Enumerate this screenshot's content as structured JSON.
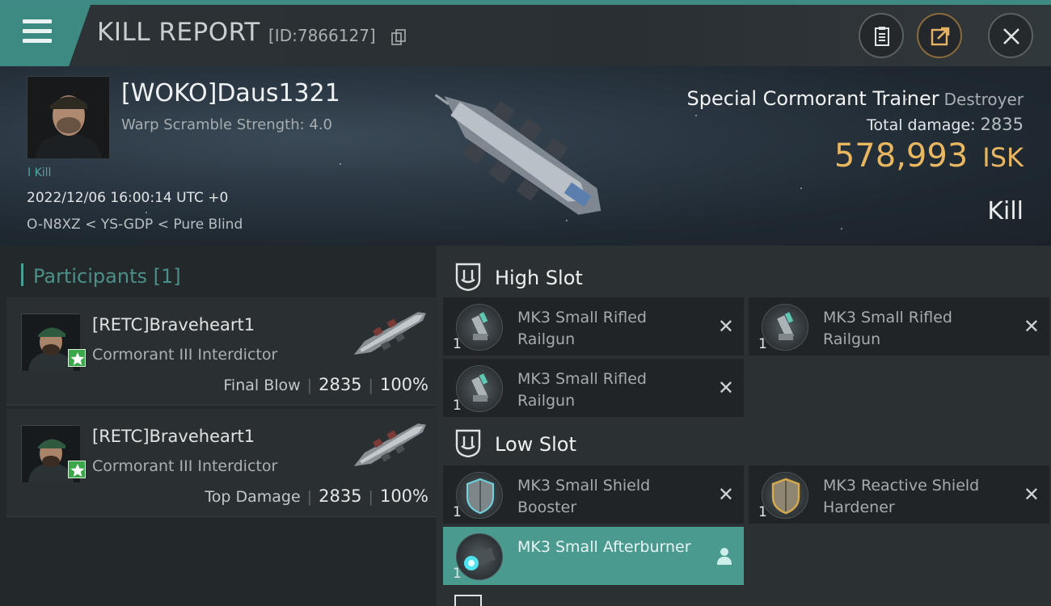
{
  "header": {
    "title": "KILL REPORT",
    "report_id": "[ID:7866127]",
    "icons": [
      "menu-icon",
      "copy-icon",
      "clipboard-icon",
      "share-icon",
      "close-icon"
    ]
  },
  "victim": {
    "name": "[WOKO]Daus1321",
    "subtitle": "Warp Scramble Strength: 4.0",
    "kill_tag": "I Kill",
    "datetime": "2022/12/06 16:00:14 UTC +0",
    "location": "O-N8XZ < YS-GDP < Pure Blind",
    "ship_name": "Special Cormorant Trainer",
    "ship_class": "Destroyer",
    "damage_label": "Total damage:",
    "damage_value": "2835",
    "isk_value": "578,993",
    "isk_unit": "ISK",
    "result": "Kill"
  },
  "participants": {
    "label": "Participants",
    "count": "[1]",
    "items": [
      {
        "name": "[RETC]Braveheart1",
        "ship": "Cormorant III Interdictor",
        "role": "Final Blow",
        "damage": "2835",
        "percent": "100%"
      },
      {
        "name": "[RETC]Braveheart1",
        "ship": "Cormorant III Interdictor",
        "role": "Top Damage",
        "damage": "2835",
        "percent": "100%"
      }
    ]
  },
  "fitting": {
    "high_slot": {
      "label": "High Slot",
      "modules": [
        {
          "name": "MK3 Small Rifled Railgun",
          "qty": "1"
        },
        {
          "name": "MK3 Small Rifled Railgun",
          "qty": "1"
        },
        {
          "name": "MK3 Small Rifled Railgun",
          "qty": "1"
        }
      ]
    },
    "low_slot": {
      "label": "Low Slot",
      "modules": [
        {
          "name": "MK3 Small Shield Booster",
          "qty": "1"
        },
        {
          "name": "MK3 Reactive Shield Hardener",
          "qty": "1"
        },
        {
          "name": "MK3 Small Afterburner",
          "qty": "1"
        }
      ]
    }
  },
  "colors": {
    "accent": "#3d8a82",
    "isk": "#e9b760",
    "active_module": "#4b9a90"
  }
}
